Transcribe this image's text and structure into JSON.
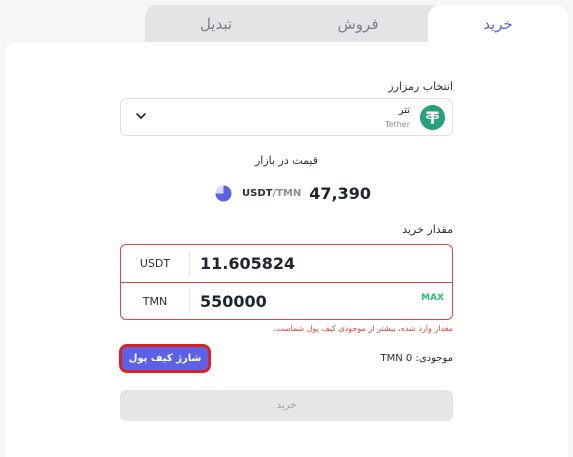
{
  "tabs": [
    {
      "label": "تبدیل"
    },
    {
      "label": "فروش"
    },
    {
      "label": "خرید"
    }
  ],
  "active_tab": "خرید",
  "crypto_select": {
    "label": "انتخاب رمزارز",
    "coin_name": "تتر",
    "coin_sub": "Tether",
    "icon": "tether-icon",
    "icon_color": "#26a17b"
  },
  "market_price": {
    "title": "قیمت در بازار",
    "pair_base": "USDT",
    "pair_quote": "/TMN",
    "price": "47,390"
  },
  "amount": {
    "label": "مقدار خرید",
    "usdt_unit": "USDT",
    "usdt_value": "11.605824",
    "tmn_unit": "TMN",
    "tmn_value": "550000",
    "max_label": "MAX",
    "error": "مقدار وارد شده، بیشتر از موجودی کیف پول شماست."
  },
  "wallet": {
    "charge_button": "شارژ کیف پول",
    "balance": "موجودی: TMN 0"
  },
  "buy_button": "خرید",
  "colors": {
    "accent": "#5b62e8",
    "error": "#e2434b",
    "max": "#2fbf71"
  }
}
